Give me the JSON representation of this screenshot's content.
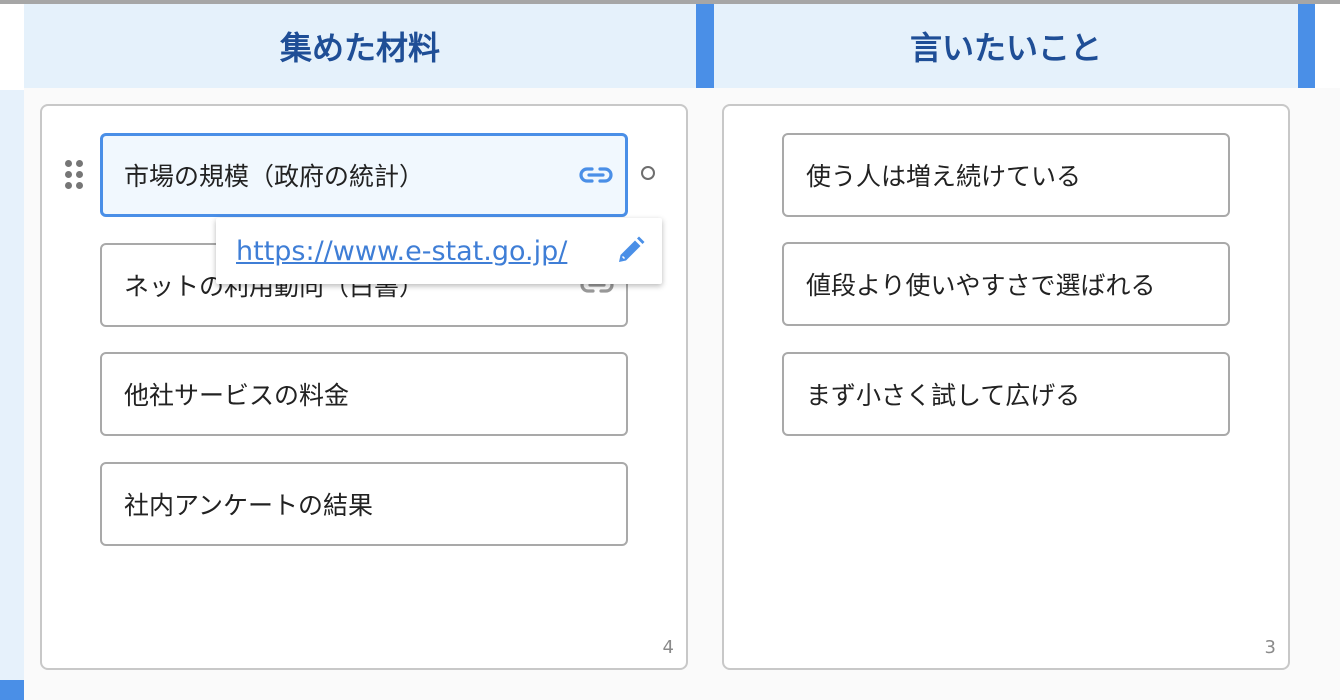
{
  "left_column": {
    "title": "集めた材料",
    "count": "4",
    "cards": [
      {
        "label": "市場の規模（政府の統計）",
        "link_icon": "link-icon",
        "selected": true
      },
      {
        "label": "ネットの利用動向（白書）",
        "link_icon": "link-icon",
        "selected": false
      },
      {
        "label": "他社サービスの料金",
        "selected": false
      },
      {
        "label": "社内アンケートの結果",
        "selected": false
      }
    ]
  },
  "right_column": {
    "title": "言いたいこと",
    "count": "3",
    "cards": [
      {
        "label": "使う人は増え続けている"
      },
      {
        "label": "値段より使いやすさで選ばれる"
      },
      {
        "label": "まず小さく試して広げる"
      }
    ]
  },
  "link_popover": {
    "url": "https://www.e-stat.go.jp/",
    "edit_icon": "pencil-icon"
  },
  "icons": {
    "drag": "drag-handle-icon",
    "select": "radio-circle-icon"
  },
  "colors": {
    "accent": "#4a8fe7",
    "header_bg": "#e5f1fb",
    "header_text": "#1f4e96",
    "link": "#3f7ed6"
  }
}
